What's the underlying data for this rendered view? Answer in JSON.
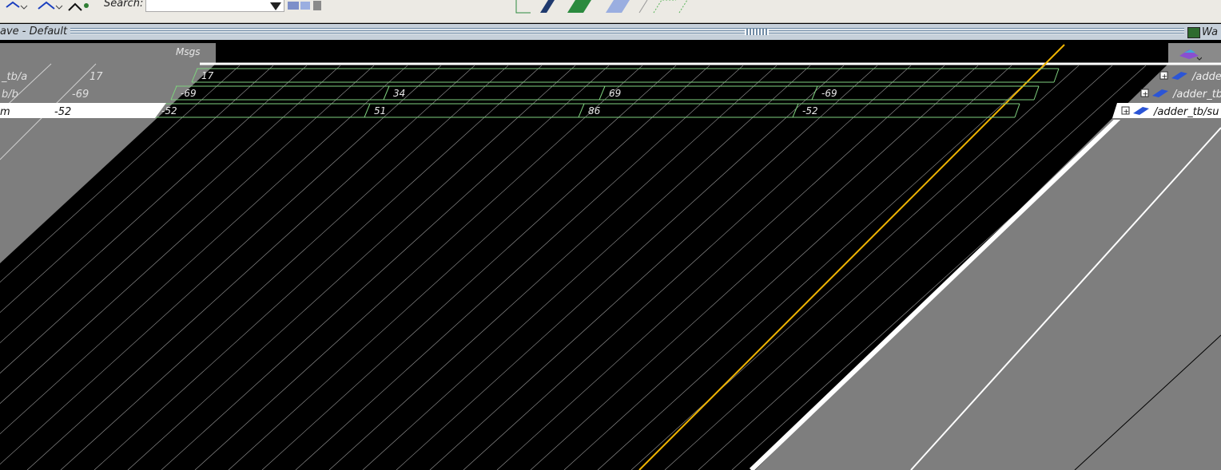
{
  "toolbar": {
    "search_label": "Search:",
    "search_value": ""
  },
  "window": {
    "title": "ave - Default",
    "right_title": "Wa"
  },
  "header": {
    "values_column": "Msgs"
  },
  "signals": [
    {
      "name": "_tb/a",
      "value": "17",
      "selected": false
    },
    {
      "name": "b/b",
      "value": "-69",
      "selected": false
    },
    {
      "name": "m",
      "value": "-52",
      "selected": true
    }
  ],
  "waveforms": [
    {
      "segments": [
        "17"
      ]
    },
    {
      "segments": [
        "-69",
        "34",
        "69",
        "-69"
      ]
    },
    {
      "segments": [
        "-52",
        "51",
        "86",
        "-52"
      ]
    }
  ],
  "objects": [
    {
      "label": "/adde"
    },
    {
      "label": "/adder_tb"
    },
    {
      "label": "/adder_tb/su"
    }
  ],
  "colors": {
    "wave_bg": "#000000",
    "wave_line": "#7fd07f",
    "cursor": "#f0b400",
    "pane_gray": "#7e7e7e",
    "grid": "#9a9a9a"
  }
}
